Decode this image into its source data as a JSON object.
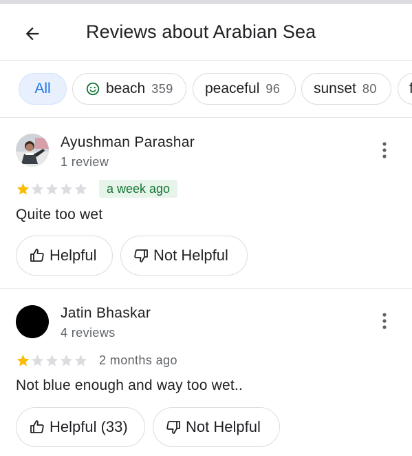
{
  "header": {
    "title": "Reviews about Arabian Sea",
    "back_icon": "arrow-back-icon"
  },
  "filters": [
    {
      "label": "All",
      "selected": true
    },
    {
      "label": "beach",
      "count": "359",
      "icon": "smiley-icon"
    },
    {
      "label": "peaceful",
      "count": "96"
    },
    {
      "label": "sunset",
      "count": "80"
    },
    {
      "label": "f"
    }
  ],
  "reviews": [
    {
      "author": "Ayushman Parashar",
      "author_meta": "1 review",
      "rating": 1,
      "max_rating": 5,
      "time": "a week ago",
      "text": "Quite too wet",
      "helpful_label": "Helpful",
      "not_helpful_label": "Not Helpful"
    },
    {
      "author": "Jatin Bhaskar",
      "author_meta": "4 reviews",
      "rating": 1,
      "max_rating": 5,
      "time": "2 months ago",
      "text": "Not blue enough and way too wet..",
      "helpful_label": "Helpful (33)",
      "not_helpful_label": "Not Helpful"
    }
  ],
  "colors": {
    "star_filled": "#fbbc04",
    "star_empty": "#dadce0",
    "accent": "#1a73e8",
    "badge_bg": "#e6f4ea",
    "badge_text": "#137333"
  }
}
